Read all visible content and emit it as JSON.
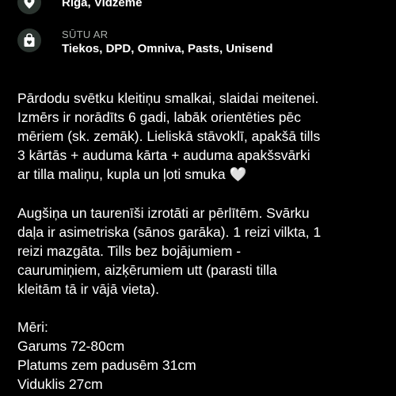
{
  "location": {
    "icon": "location-pin-icon",
    "value": "Riga, Vidzeme"
  },
  "shipping": {
    "icon": "shopping-bag-icon",
    "caption": "SŪTU AR",
    "value": "Tiekos, DPD, Omniva, Pasts, Unisend"
  },
  "colors": {
    "background": "#000000",
    "icon_circle": "#2b342f",
    "caption": "#a9aeab",
    "text": "#ffffff"
  },
  "description": {
    "paragraph1": [
      "Pārdodu svētku kleitiņu smalkai, slaidai meitenei.",
      "Izmērs ir norādīts 6 gadi, labāk orientēties pēc",
      "mēriem (sk. zemāk).  Lieliskā stāvoklī, apakšā tills",
      "3 kārtās + auduma kārta + auduma apakšsvārki",
      "ar tilla maliņu, kupla un ļoti smuka"
    ],
    "heart": "🤍",
    "paragraph2": [
      "Augšiņa un taurenīši izrotāti ar pērlītēm. Svārku",
      "daļa ir asimetriska (sānos garāka). 1 reizi vilkta, 1",
      "reizi mazgāta. Tills bez bojājumiem -",
      "caurumiņiem, aizķērumiem utt (parasti tilla",
      "kleitām tā ir vājā vieta)."
    ],
    "measurements_title": "Mēri:",
    "measurements": [
      "Garums 72-80cm",
      "Platums zem padusēm 31cm",
      "Viduklis 27cm"
    ]
  }
}
